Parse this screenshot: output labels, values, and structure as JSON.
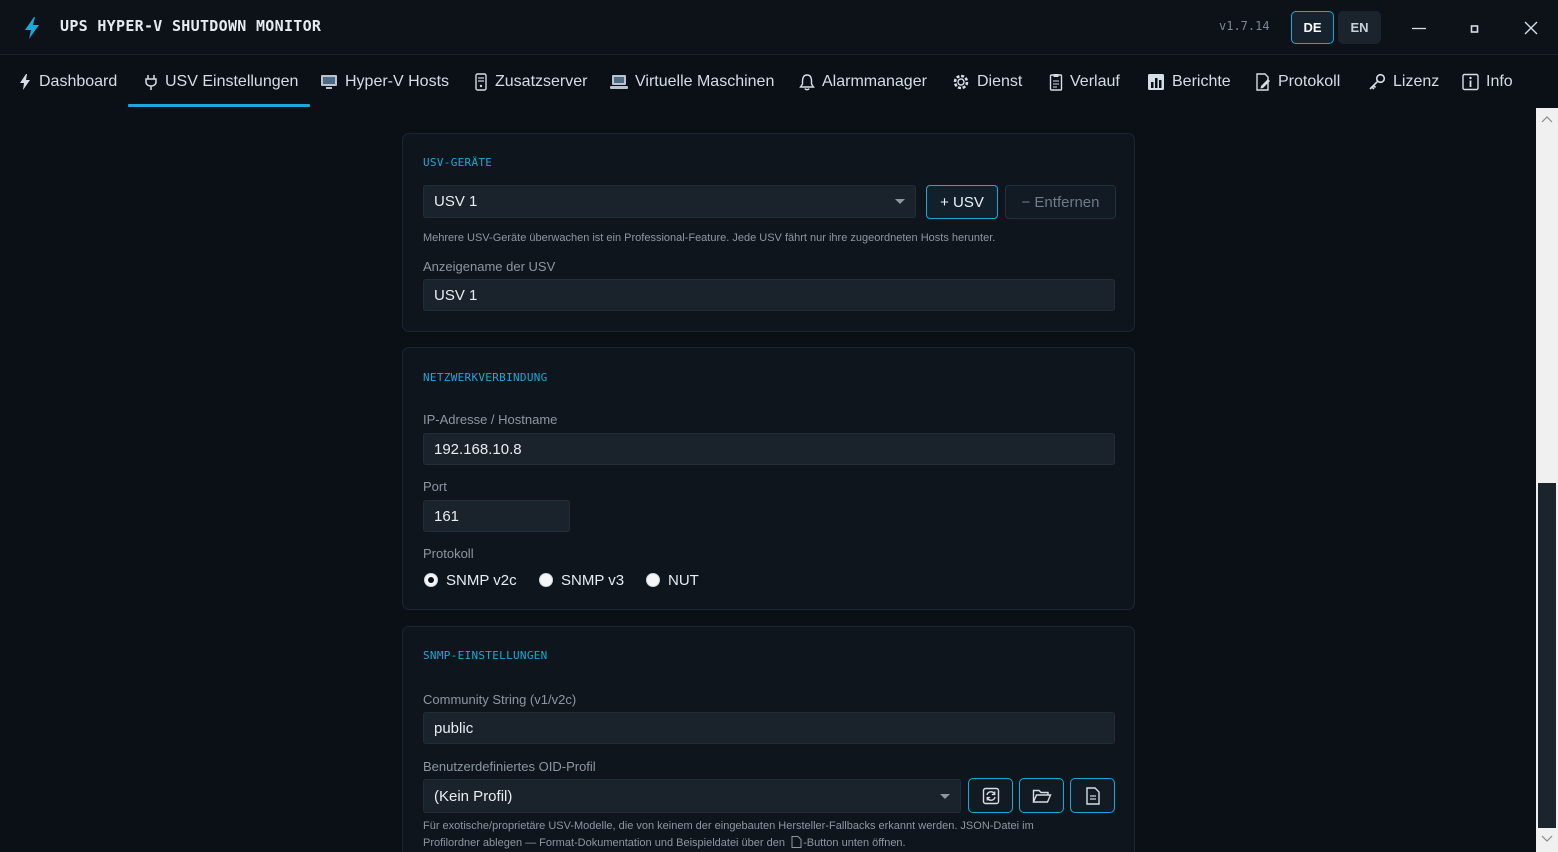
{
  "app": {
    "title": "UPS HYPER-V SHUTDOWN MONITOR",
    "version": "v1.7.14",
    "accent_color": "#1ba8d6",
    "languages": {
      "de": "DE",
      "en": "EN",
      "selected": "DE"
    }
  },
  "nav": {
    "tabs": [
      {
        "label": "Dashboard",
        "icon": "lightning-icon"
      },
      {
        "label": "USV Einstellungen",
        "icon": "plug-icon",
        "active": true
      },
      {
        "label": "Hyper-V Hosts",
        "icon": "monitor-icon"
      },
      {
        "label": "Zusatzserver",
        "icon": "server-icon"
      },
      {
        "label": "Virtuelle Maschinen",
        "icon": "laptop-icon"
      },
      {
        "label": "Alarmmanager",
        "icon": "bell-icon"
      },
      {
        "label": "Dienst",
        "icon": "gear-icon"
      },
      {
        "label": "Verlauf",
        "icon": "clipboard-icon"
      },
      {
        "label": "Berichte",
        "icon": "bar-chart-icon"
      },
      {
        "label": "Protokoll",
        "icon": "edit-document-icon"
      },
      {
        "label": "Lizenz",
        "icon": "key-icon"
      },
      {
        "label": "Info",
        "icon": "info-icon"
      }
    ]
  },
  "usv_devices": {
    "section_title": "USV-GERÄTE",
    "selected_device": "USV 1",
    "add_button": "+ USV",
    "remove_button": "− Entfernen",
    "hint": "Mehrere USV-Geräte überwachen ist ein Professional-Feature. Jede USV fährt nur ihre zugeordneten Hosts herunter.",
    "display_name_label": "Anzeigename der USV",
    "display_name_value": "USV 1"
  },
  "network": {
    "section_title": "NETZWERKVERBINDUNG",
    "ip_label": "IP-Adresse / Hostname",
    "ip_value": "192.168.10.8",
    "port_label": "Port",
    "port_value": "161",
    "protocol_label": "Protokoll",
    "protocols": [
      {
        "label": "SNMP v2c",
        "checked": true
      },
      {
        "label": "SNMP v3",
        "checked": false
      },
      {
        "label": "NUT",
        "checked": false
      }
    ]
  },
  "snmp": {
    "section_title": "SNMP-EINSTELLUNGEN",
    "community_label": "Community String (v1/v2c)",
    "community_value": "public",
    "oid_profile_label": "Benutzerdefiniertes OID-Profil",
    "oid_profile_value": "(Kein Profil)",
    "hint_line1": "Für exotische/proprietäre USV-Modelle, die von keinem der eingebauten Hersteller-Fallbacks erkannt werden. JSON-Datei im",
    "hint_line2_before": "Profilordner ablegen — Format-Dokumentation und Beispieldatei über den",
    "hint_line2_after": "-Button unten öffnen."
  }
}
